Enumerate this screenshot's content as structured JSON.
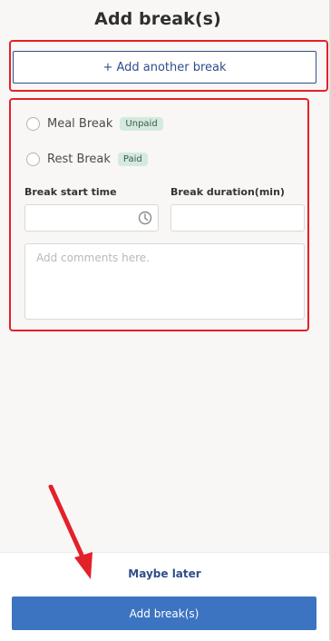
{
  "header": {
    "title": "Add break(s)"
  },
  "actions": {
    "add_another_label": "+ Add another break"
  },
  "break_card": {
    "options": [
      {
        "label": "Meal Break",
        "badge": "Unpaid"
      },
      {
        "label": "Rest Break",
        "badge": "Paid"
      }
    ],
    "start_time_label": "Break start time",
    "start_time_value": "",
    "duration_label": "Break duration(min)",
    "duration_value": "",
    "comments_placeholder": "Add comments here.",
    "icons": {
      "time": "clock-icon"
    }
  },
  "footer": {
    "maybe_later_label": "Maybe later",
    "submit_label": "Add break(s)"
  },
  "colors": {
    "accent": "#2f4e8a",
    "primary_button": "#3d74c2",
    "badge_bg": "#d4eadf",
    "annotation_red": "#e3212a"
  }
}
